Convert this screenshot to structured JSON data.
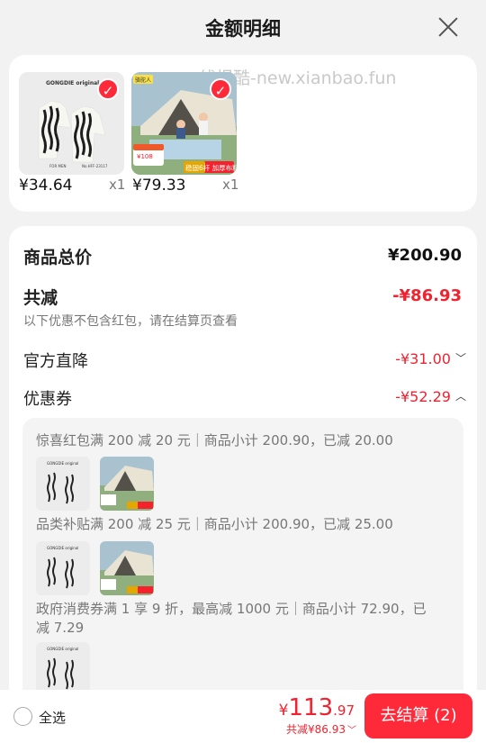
{
  "header": {
    "title": "金额明细"
  },
  "watermark": "线报酷-new.xianbao.fun",
  "products": [
    {
      "price": "¥34.64",
      "qty": "x1",
      "image_text": "GONGDIE original",
      "selected": true
    },
    {
      "price": "¥79.33",
      "qty": "x1",
      "image_badge": "稳固6杆 加厚布料",
      "image_tag": "¥108",
      "brand_tag": "骆驼人",
      "selected": true
    }
  ],
  "summary": {
    "total_label": "商品总价",
    "total_value": "¥200.90",
    "discount_label": "共减",
    "discount_value": "-¥86.93",
    "note": "以下优惠不包含红包，请在结算页查看",
    "official_label": "官方直降",
    "official_value": "-¥31.00",
    "official_chevron": "﹀",
    "coupon_label": "优惠券",
    "coupon_value": "-¥52.29",
    "coupon_chevron": "︿"
  },
  "coupons": [
    {
      "text": "惊喜红包满 200 减 20 元｜商品小计 200.90，已减 20.00"
    },
    {
      "text": "品类补贴满 200 减 25 元｜商品小计 200.90，已减 25.00"
    },
    {
      "text": "政府消费券满 1 享 9 折，最高减 1000 元｜商品小计 72.90，已减 7.29"
    }
  ],
  "bottom": {
    "select_all": "全选",
    "currency": "¥",
    "amount_int": "113",
    "amount_dec": ".97",
    "saved": "共减¥86.93",
    "saved_chevron": "﹀",
    "checkout": "去结算 (2)"
  },
  "colors": {
    "accent": "#fe2a3a",
    "price_red": "#f0222f"
  }
}
